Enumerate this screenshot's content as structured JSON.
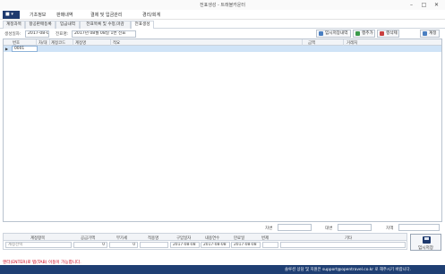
{
  "window": {
    "title": "전표생성 - 트래블카운터",
    "minimize": "–",
    "maximize": "□",
    "close": "✕"
  },
  "menu": {
    "home": "■ ▾",
    "items": [
      "기초정보",
      "판매내역",
      "결제 및 입금관리",
      "경리/회계"
    ]
  },
  "tabs": [
    "계정과목",
    "항공판매등록",
    "입금내역",
    "전표목록 및 수정,마감",
    "전표생성"
  ],
  "toolbar": {
    "date_label": "생성일자:",
    "date_value": "2017-08-08",
    "voucher_label": "전표명:",
    "voucher_value": "2017년 08월 08일 1번 전표",
    "buttons": [
      "임시저장내역",
      "행추가",
      "행삭제",
      "계정"
    ]
  },
  "grid": {
    "columns": [
      "번호",
      "차/대",
      "계정코드",
      "계정명",
      "적요",
      "금액",
      "거래처"
    ],
    "rows": [
      {
        "marker": "▶",
        "no": "0001"
      }
    ]
  },
  "totals": {
    "debit_label": "차변",
    "credit_label": "대변",
    "diff_label": "차액"
  },
  "entry": {
    "columns": [
      "계정항목",
      "공급가액",
      "부가세",
      "적용명",
      "구입일자",
      "내용연수",
      "만료일",
      "번제",
      "기타"
    ],
    "account_placeholder": "계정선택",
    "supply_amount": "0",
    "vat": "0",
    "purchase_date": "2017-08-08",
    "useful_life": "2017-08-08",
    "expiry_date": "2017-08-08",
    "save_label": "임시저장"
  },
  "hint": "엔터(ENTER)로 탭(TAB) 이동이 가능합니다.",
  "status": "솔루션 상담 및 지원은 support@opentravel.co.kr 로 해주시기 바랍니다.",
  "colors": {
    "accent": "#1e3a6e",
    "status_bar": "#1f3f73",
    "selected_row": "#cfe3f7",
    "hint_text": "#d0021b"
  }
}
